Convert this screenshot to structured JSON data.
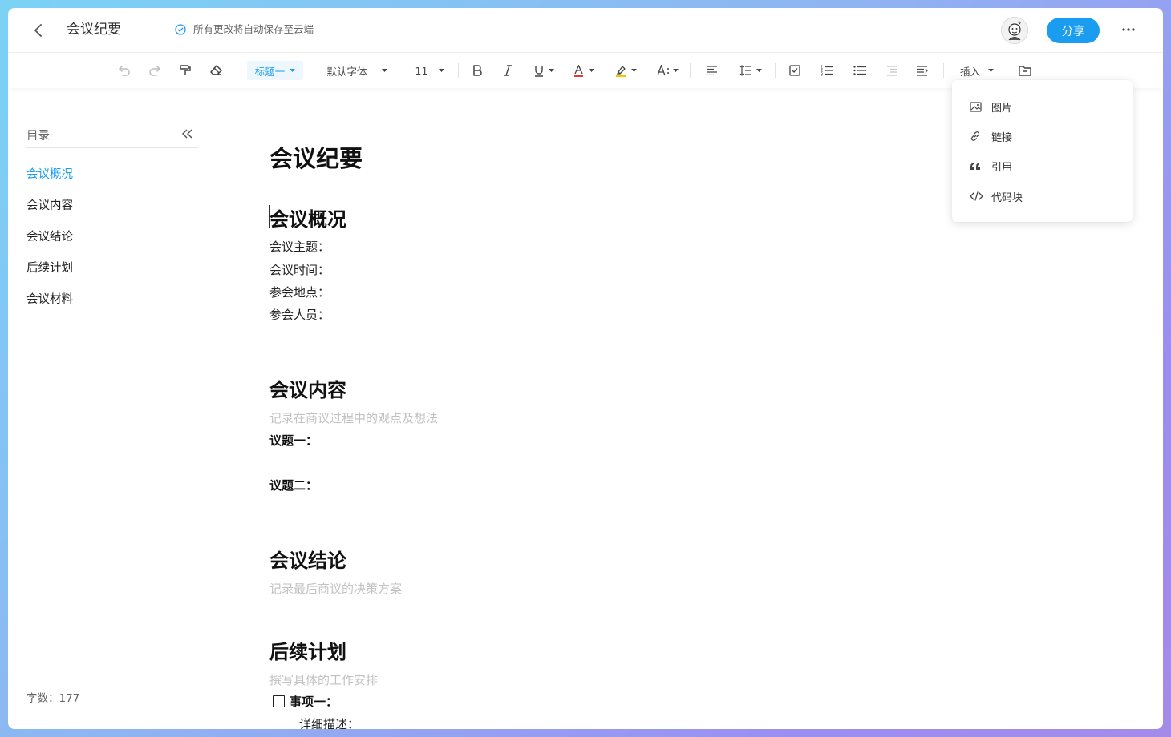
{
  "header": {
    "title": "会议纪要",
    "save_status": "所有更改将自动保存至云端",
    "share_label": "分享"
  },
  "toolbar": {
    "heading_select": "标题一",
    "font_family": "默认字体",
    "font_size": "11",
    "insert_label": "插入",
    "font_color_accent": "#e53935",
    "highlight_accent": "#f5c400"
  },
  "sidebar": {
    "toc_title": "目录",
    "items": [
      {
        "label": "会议概况",
        "active": true
      },
      {
        "label": "会议内容",
        "active": false
      },
      {
        "label": "会议结论",
        "active": false
      },
      {
        "label": "后续计划",
        "active": false
      },
      {
        "label": "会议材料",
        "active": false
      }
    ],
    "word_count": "字数：177"
  },
  "document": {
    "title": "会议纪要",
    "section1": {
      "heading": "会议概况",
      "lines": [
        "会议主题：",
        "会议时间：",
        "参会地点：",
        "参会人员："
      ]
    },
    "section2": {
      "heading": "会议内容",
      "hint": "记录在商议过程中的观点及想法",
      "topic1": "议题一：",
      "topic2": "议题二："
    },
    "section3": {
      "heading": "会议结论",
      "hint": "记录最后商议的决策方案"
    },
    "section4": {
      "heading": "后续计划",
      "hint": "撰写具体的工作安排",
      "task1": "事项一：",
      "task1_detail": "详细描述："
    }
  },
  "insert_menu": {
    "items": [
      {
        "label": "图片",
        "icon": "image-icon"
      },
      {
        "label": "链接",
        "icon": "link-icon"
      },
      {
        "label": "引用",
        "icon": "quote-icon"
      },
      {
        "label": "代码块",
        "icon": "code-icon"
      }
    ]
  },
  "colors": {
    "accent": "#1a9cf0"
  }
}
